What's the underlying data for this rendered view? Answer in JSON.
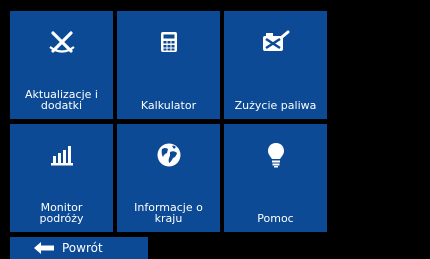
{
  "tiles": [
    {
      "label": "Aktualizacje i\ndodatki",
      "icon": "tools-update-icon"
    },
    {
      "label": "Kalkulator",
      "icon": "calculator-icon"
    },
    {
      "label": "Zużycie paliwa",
      "icon": "fuel-consumption-icon"
    },
    {
      "label": "Monitor\npodróży",
      "icon": "trip-monitor-bar-chart-icon"
    },
    {
      "label": "Informacje o\nkraju",
      "icon": "globe-icon"
    },
    {
      "label": "Pomoc",
      "icon": "lightbulb-icon"
    }
  ],
  "back_button": {
    "label": "Powrót",
    "icon": "back-arrow-icon"
  },
  "colors": {
    "tile": "#0c4a95",
    "background": "#000000",
    "text": "#ffffff"
  }
}
